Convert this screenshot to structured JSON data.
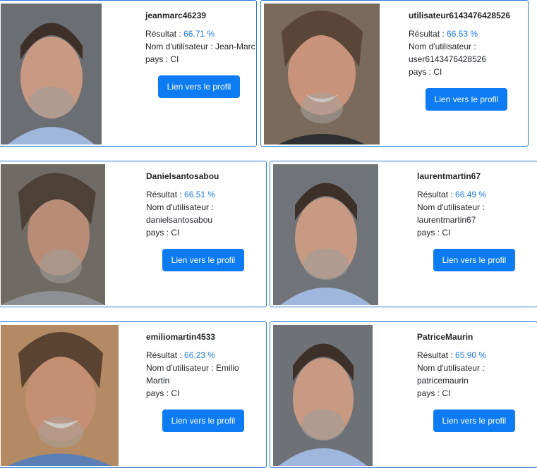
{
  "result_label": "Résultat : ",
  "results": [
    {
      "username": "jeanmarc46239",
      "score": "66.71 %",
      "name_lines": [
        "Nom d'utilisateur : Jean-Marc"
      ],
      "country": "pays : CI",
      "button": "Lien vers le profil"
    },
    {
      "username": "utilisateur6143476428526",
      "score": "66.53 %",
      "name_lines": [
        "Nom d'utilisateur :",
        "user6143476428526"
      ],
      "country": "pays : CI",
      "button": "Lien vers le profil"
    },
    {
      "username": "Danielsantosabou",
      "score": "66.51 %",
      "name_lines": [
        "Nom d'utilisateur :",
        "danielsantosabou"
      ],
      "country": "pays : CI",
      "button": "Lien vers le profil"
    },
    {
      "username": "laurentmartin67",
      "score": "66.49 %",
      "name_lines": [
        "Nom d'utilisateur :",
        "laurentmartin67"
      ],
      "country": "pays : CI",
      "button": "Lien vers le profil"
    },
    {
      "username": "emiliomartin4533",
      "score": "66.23 %",
      "name_lines": [
        "Nom d'utilisateur : Emilio",
        "Martin"
      ],
      "country": "pays : CI",
      "button": "Lien vers le profil"
    },
    {
      "username": "PatriceMaurin",
      "score": "65.90 %",
      "name_lines": [
        "Nom d'utilisateur :",
        "patricemaurin"
      ],
      "country": "pays : CI",
      "button": "Lien vers le profil"
    }
  ]
}
